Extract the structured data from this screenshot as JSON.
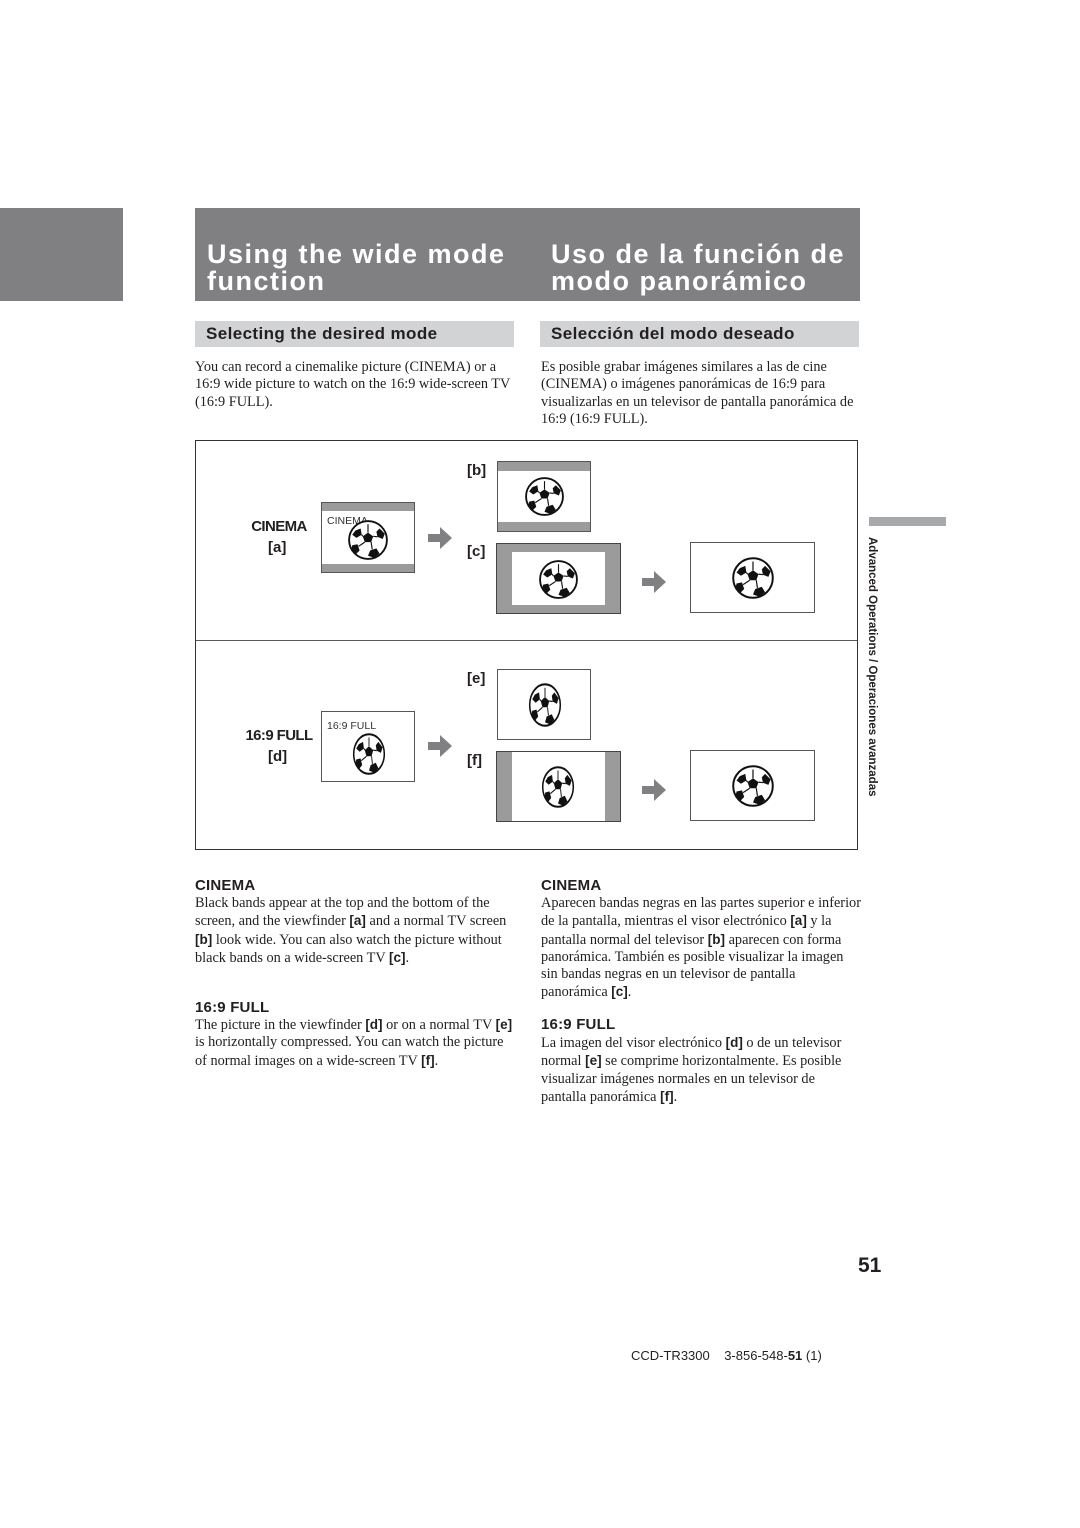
{
  "header": {
    "title_en": "Using the wide mode function",
    "title_es": "Uso de la función de modo panorámico",
    "title_bg_color": "#808083"
  },
  "subheader": {
    "en": "Selecting the desired mode",
    "es": "Selección del modo deseado",
    "bg_color": "#d2d3d5"
  },
  "intro": {
    "en": "You can record a cinemalike picture (CINEMA) or a 16:9 wide picture to watch on the 16:9 wide-screen TV (16:9 FULL).",
    "es": "Es posible grabar imágenes similares a las de cine (CINEMA) o imágenes panorámicas de 16:9 para visualizarlas en un televisor de pantalla panorámica de 16:9 (16:9 FULL)."
  },
  "diagram": {
    "cinema": {
      "mode_label": "CINEMA",
      "viewfinder_tag": "[a]",
      "viewfinder_caption": "CINEMA",
      "normal_tv_tag": "[b]",
      "wide_tv_tag": "[c]"
    },
    "full": {
      "mode_label": "16:9 FULL",
      "viewfinder_tag": "[d]",
      "viewfinder_caption": "16:9 FULL",
      "normal_tv_tag": "[e]",
      "wide_tv_tag": "[f]"
    },
    "icons": [
      "soccer-ball-icon",
      "arrow-right-icon"
    ],
    "band_color": "#9b9b9b"
  },
  "side_index": {
    "label": "Advanced Operations / Operaciones avanzadas"
  },
  "sections": {
    "en": {
      "cinema_heading": "CINEMA",
      "cinema_text": [
        {
          "t": "Black bands appear at the top and the bottom of the screen, and the viewfinder "
        },
        {
          "b": "[a]"
        },
        {
          "t": " and a normal TV screen "
        },
        {
          "b": "[b]"
        },
        {
          "t": " look wide. You can also watch the picture without black bands on a wide-screen TV "
        },
        {
          "b": "[c]"
        },
        {
          "t": "."
        }
      ],
      "full_heading": "16:9 FULL",
      "full_text": [
        {
          "t": "The picture in the viewfinder "
        },
        {
          "b": "[d]"
        },
        {
          "t": " or on a normal TV "
        },
        {
          "b": "[e]"
        },
        {
          "t": " is horizontally compressed. You can watch the picture of normal images on a wide-screen TV "
        },
        {
          "b": "[f]"
        },
        {
          "t": "."
        }
      ]
    },
    "es": {
      "cinema_heading": "CINEMA",
      "cinema_text": [
        {
          "t": "Aparecen bandas negras en las partes superior e inferior de la pantalla, mientras el visor electrónico "
        },
        {
          "b": "[a]"
        },
        {
          "t": " y la pantalla normal del televisor "
        },
        {
          "b": "[b]"
        },
        {
          "t": " aparecen con forma panorámica. También es posible visualizar la imagen sin bandas negras en un televisor de pantalla panorámica "
        },
        {
          "b": "[c]"
        },
        {
          "t": "."
        }
      ],
      "full_heading": "16:9 FULL",
      "full_text": [
        {
          "t": "La imagen del visor electrónico "
        },
        {
          "b": "[d]"
        },
        {
          "t": " o de un televisor normal "
        },
        {
          "b": "[e]"
        },
        {
          "t": " se comprime horizontalmente. Es posible visualizar imágenes normales en un televisor de pantalla panorámica "
        },
        {
          "b": "[f]"
        },
        {
          "t": "."
        }
      ]
    }
  },
  "page_number": "51",
  "footer": {
    "model": "CCD-TR3300",
    "code_prefix": "3-856-548-",
    "code_bold": "51",
    "code_suffix": "(1)"
  }
}
